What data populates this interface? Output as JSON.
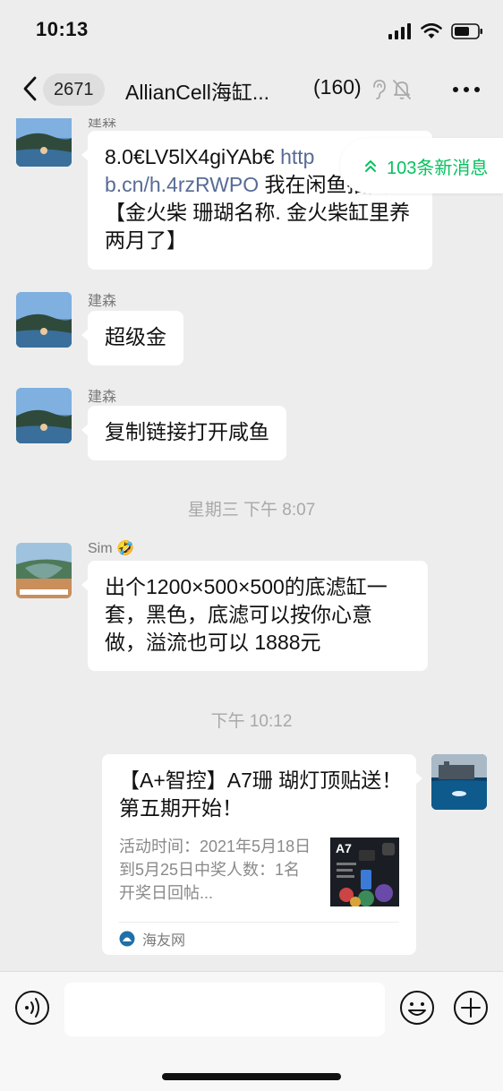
{
  "status_bar": {
    "time": "10:13"
  },
  "nav": {
    "unread_count": "2671",
    "title": "AllianCell海缸...",
    "member_count": "(160)"
  },
  "new_messages_badge": "103条新消息",
  "messages": [
    {
      "sender": "建森",
      "parts": [
        "8.0€LV5lX4giYAb€ ",
        "http",
        "b.cn/h.4rzRWPO",
        " 我在闲鱼拍卖【金火柴 珊瑚名称. 金火柴缸里养两月了】"
      ]
    },
    {
      "sender": "建森",
      "text": "超级金"
    },
    {
      "sender": "建森",
      "text": "复制链接打开咸鱼"
    },
    {
      "timestamp": "星期三 下午 8:07"
    },
    {
      "sender": "Sim",
      "sender_emoji": "🤣",
      "text": "出个1200×500×500的底滤缸一套，黑色，底滤可以按你心意做，溢流也可以 1888元"
    },
    {
      "timestamp": "下午 10:12"
    }
  ],
  "link_card": {
    "title": "【A+智控】A7珊 瑚灯顶贴送！第五期开始！",
    "description": "活动时间：2021年5月18日到5月25日中奖人数：1名开奖日回帖...",
    "thumb_label": "A7",
    "source": "海友网"
  },
  "colors": {
    "accent": "#07c160",
    "link": "#576b95",
    "background": "#ededed"
  }
}
